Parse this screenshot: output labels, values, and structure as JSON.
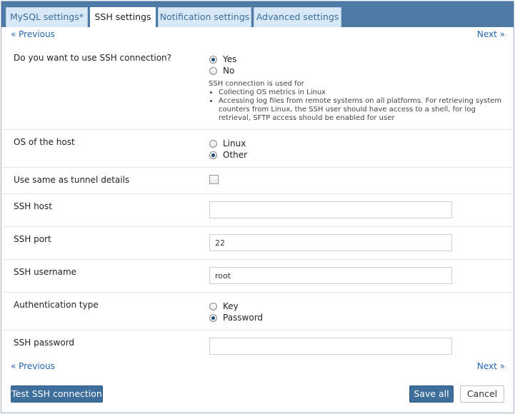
{
  "tabs": [
    {
      "label": "MySQL settings*"
    },
    {
      "label": "SSH settings"
    },
    {
      "label": "Notification settings"
    },
    {
      "label": "Advanced settings"
    }
  ],
  "nav": {
    "previous": "« Previous",
    "next": "Next »"
  },
  "ssh_connection": {
    "question": "Do you want to use SSH connection?",
    "options": [
      "Yes",
      "No"
    ],
    "selected": "Yes",
    "info_intro": "SSH connection is used for",
    "info_items": [
      "Collecting OS metrics in Linux",
      "Accessing log files from remote systems on all platforms. For retrieving system counters from Linux, the SSH user should have access to a shell, for log retrieval, SFTP access should be enabled for user"
    ]
  },
  "os": {
    "label": "OS of the host",
    "options": [
      "Linux",
      "Other"
    ],
    "selected": "Other"
  },
  "tunnel": {
    "label": "Use same as tunnel details",
    "checked": false
  },
  "ssh_host": {
    "label": "SSH host",
    "value": ""
  },
  "ssh_port": {
    "label": "SSH port",
    "value": "22"
  },
  "ssh_username": {
    "label": "SSH username",
    "value": "root"
  },
  "auth": {
    "label": "Authentication type",
    "options": [
      "Key",
      "Password"
    ],
    "selected": "Password"
  },
  "ssh_password": {
    "label": "SSH password",
    "value": ""
  },
  "buttons": {
    "test": "Test SSH connection",
    "save": "Save all",
    "cancel": "Cancel"
  }
}
